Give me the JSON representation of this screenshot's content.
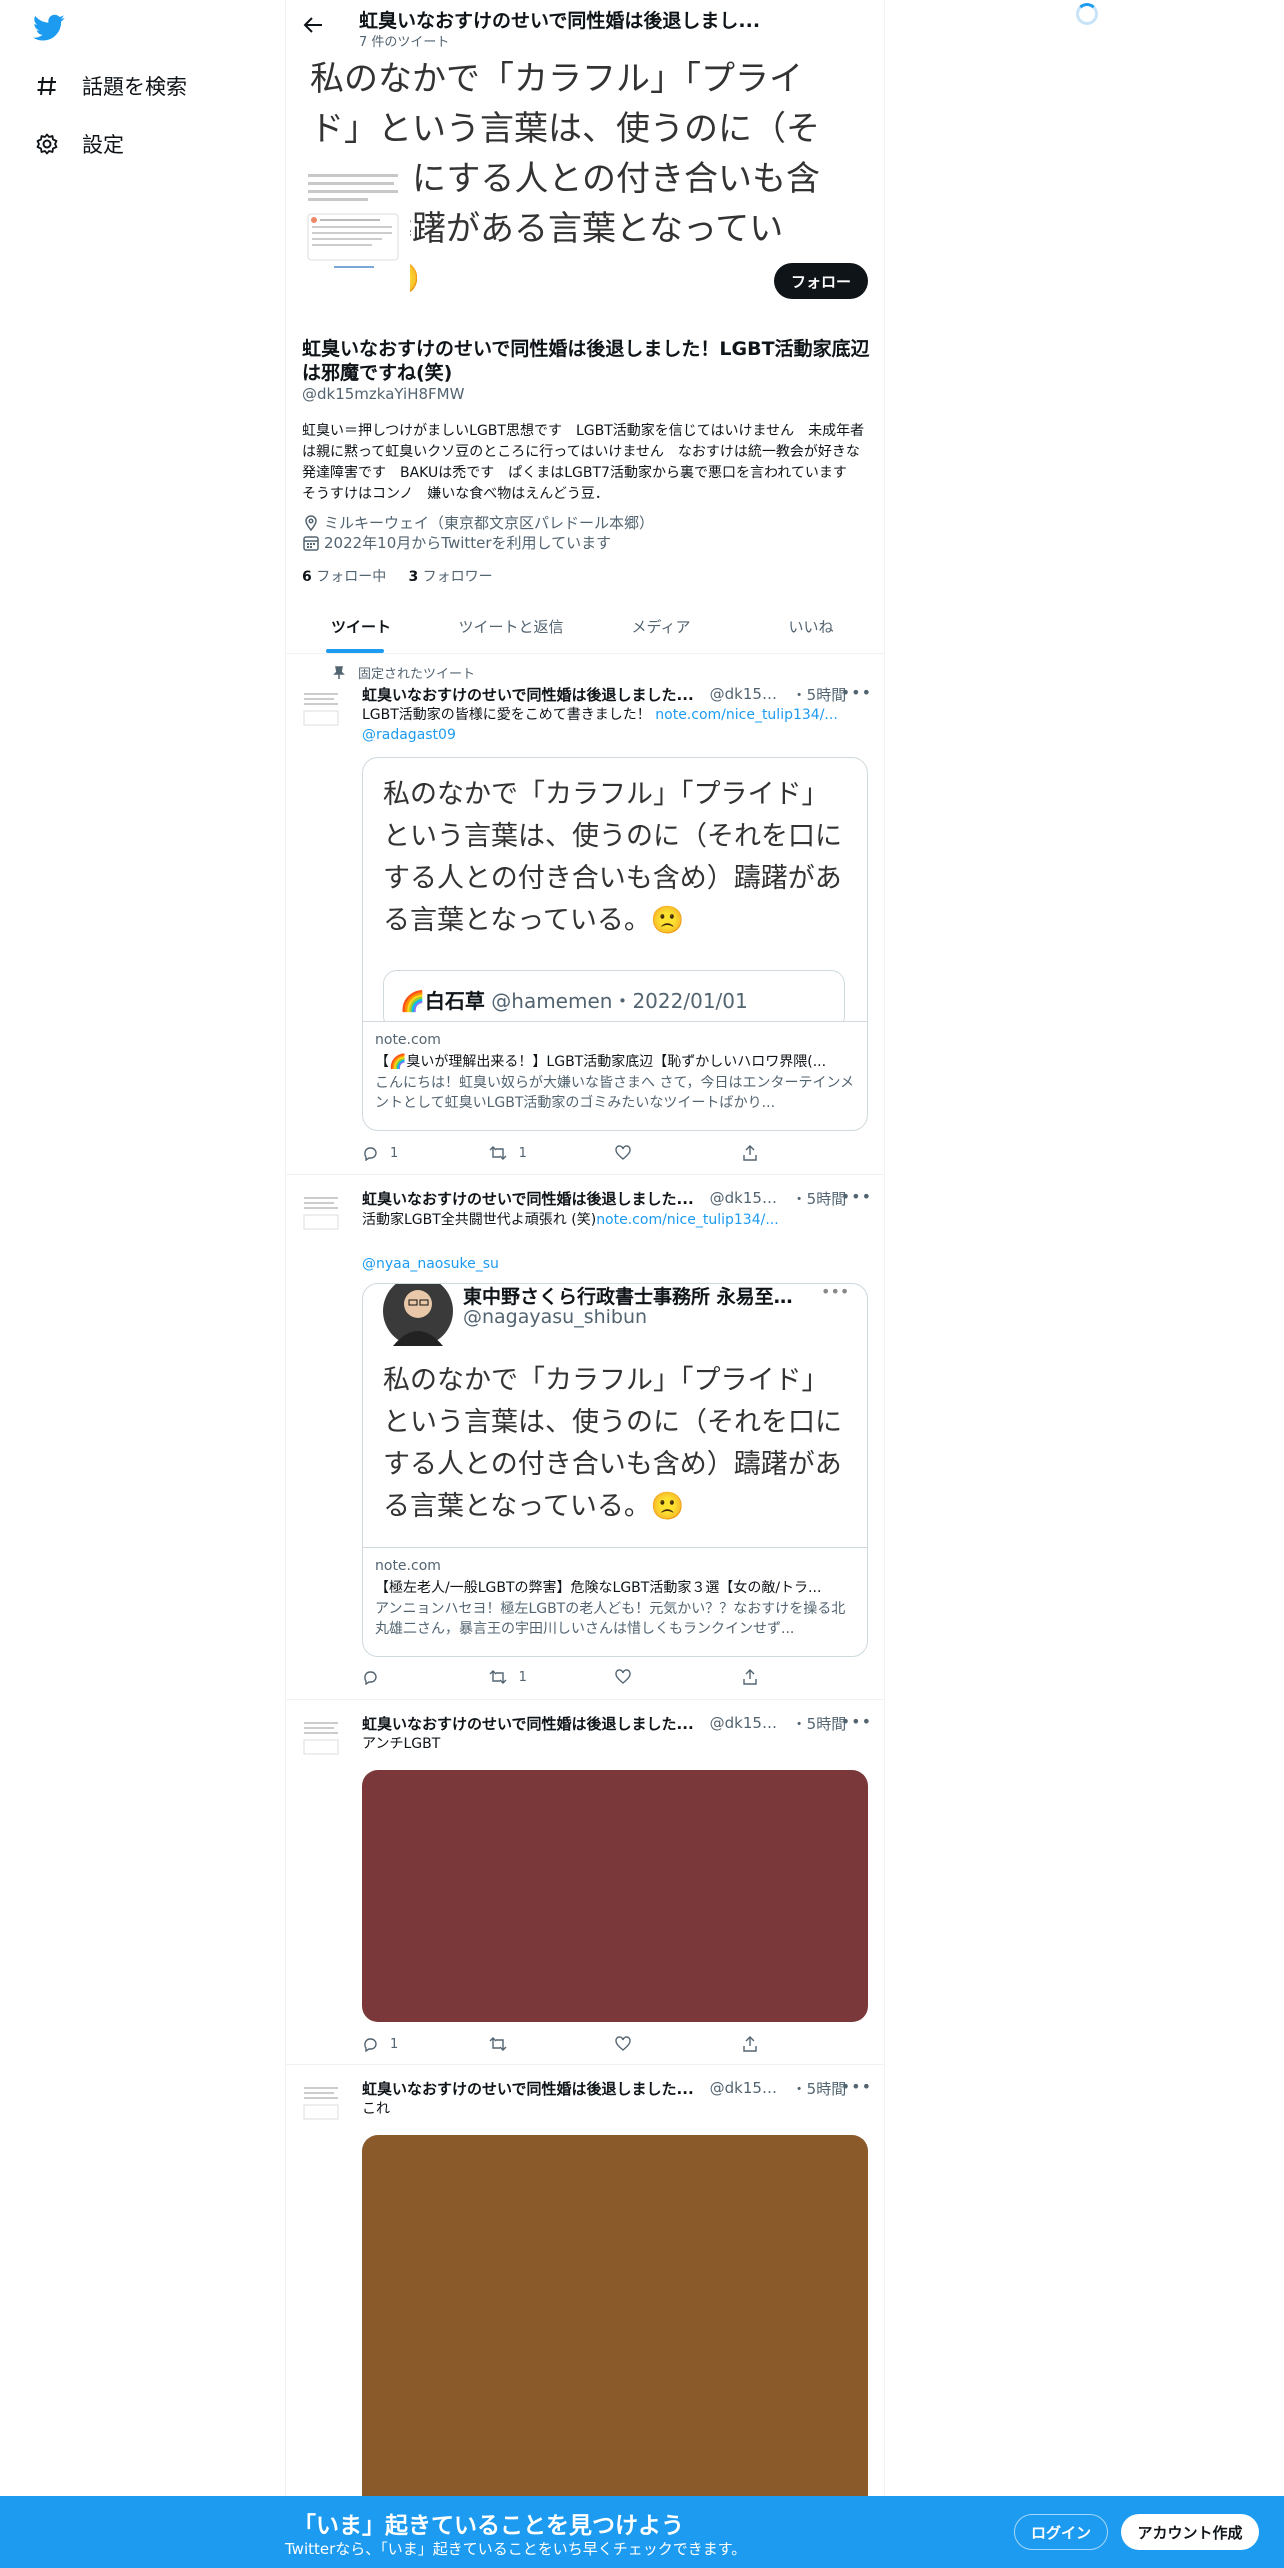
{
  "nav": {
    "logo": "twitter-bird-icon",
    "items": [
      {
        "icon": "hashtag-icon",
        "label": "話題を検索"
      },
      {
        "icon": "gear-icon",
        "label": "設定"
      }
    ]
  },
  "header": {
    "title": "虹臭いなおすけのせいで同性婚は後退しまし...",
    "tweet_count": "7 件のツイート"
  },
  "banner": {
    "text": "私のなかで「カラフル」「プライド」という言葉は、使うのに（それを口にする人との付き合いも含め）躊躇がある言葉となっている。🙁"
  },
  "profile": {
    "name": "虹臭いなおすけのせいで同性婚は後退しました！LGBT活動家底辺は邪魔ですね(笑)",
    "handle": "@dk15mzkaYiH8FMW",
    "follow_label": "フォロー",
    "bio": "虹臭い＝押しつけがましいLGBT思想です　LGBT活動家を信じてはいけません　未成年者は親に黙って虹臭いクソ豆のところに行ってはいけません　なおすけは統一教会が好きな発達障害です　BAKUは禿です　ぱくまはLGBT7活動家から裏で悪口を言われています　そうすけはコンノ　嫌いな食べ物はえんどう豆．",
    "location": "ミルキーウェイ（東京都文京区パレドール本郷）",
    "joined": "2022年10月からTwitterを利用しています",
    "following_count": "6",
    "following_label": "フォロー中",
    "followers_count": "3",
    "followers_label": "フォロワー"
  },
  "tabs": [
    "ツイート",
    "ツイートと返信",
    "メディア",
    "いいね"
  ],
  "tweets": [
    {
      "pinned_label": "固定されたツイート",
      "name": "虹臭いなおすけのせいで同性婚は後退しました...",
      "handle": "@dk15m...",
      "time": "・5時間",
      "text": "LGBT活動家の皆様に愛をこめて書きました！ ",
      "link": "note.com/nice_tulip134/...",
      "mention": "@radagast09",
      "card_quote": "私のなかで「カラフル」「プライド」という言葉は、使うのに（それを口にする人との付き合いも含め）躊躇がある言葉となっている。🙁",
      "inner_author": "🌈白石草",
      "inner_handle": "@hamemen",
      "inner_date": "・2022/01/01",
      "card_domain": "note.com",
      "card_title": "【🌈臭いが理解出来る！】LGBT活動家底辺【恥ずかしいハロワ界隈(...",
      "card_desc": "こんにちは！虹臭い奴らが大嫌いな皆さまへ さて，今日はエンターテインメントとして虹臭いLGBT活動家のゴミみたいなツイートばかり...",
      "replies": "1",
      "retweets": "1",
      "likes": ""
    },
    {
      "name": "虹臭いなおすけのせいで同性婚は後退しました...",
      "handle": "@dk15m...",
      "time": "・5時間",
      "text": "活動家LGBT全共闘世代よ頑張れ (笑)",
      "link": "note.com/nice_tulip134/...",
      "mention": "@nyaa_naosuke_su",
      "inner_author": "東中野さくら行政書士事務所 永易至文...",
      "inner_handle": "@nagayasu_shibun",
      "card_quote": "私のなかで「カラフル」「プライド」という言葉は、使うのに（それを口にする人との付き合いも含め）躊躇がある言葉となっている。🙁",
      "card_domain": "note.com",
      "card_title": "【極左老人/一般LGBTの弊害】危険なLGBT活動家３選【女の敵/トラ...",
      "card_desc": "アンニョンハセヨ！極左LGBTの老人ども！元気かい？？なおすけを操る北丸雄二さん，暴言王の宇田川しいさんは惜しくもランクインせず...",
      "replies": "",
      "retweets": "1",
      "likes": ""
    },
    {
      "name": "虹臭いなおすけのせいで同性婚は後退しました...",
      "handle": "@dk15m...",
      "time": "・5時間",
      "text": "アンチLGBT",
      "photo_color": "#7a383a",
      "replies": "1",
      "retweets": "",
      "likes": ""
    },
    {
      "name": "虹臭いなおすけのせいで同性婚は後退しました...",
      "handle": "@dk15m...",
      "time": "・5時間",
      "text": "これ",
      "photo_color": "#8b5a2b"
    }
  ],
  "bottombar": {
    "title": "「いま」起きていることを見つけよう",
    "subtitle": "Twitterなら、「いま」起きていることをいち早くチェックできます。",
    "login": "ログイン",
    "signup": "アカウント作成"
  },
  "colors": {
    "accent": "#1d9bf0",
    "text": "#0f1419",
    "muted": "#536471"
  }
}
